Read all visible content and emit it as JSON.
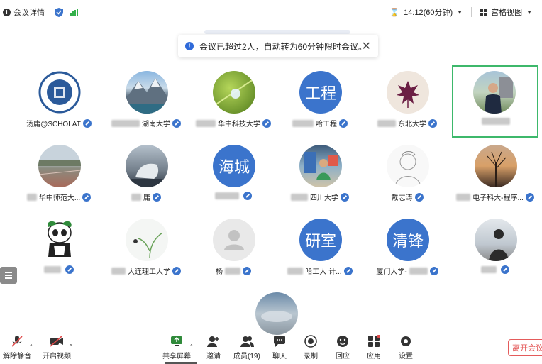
{
  "topbar": {
    "meeting_details": "会议详情",
    "timer": "14:12(60分钟)",
    "view_mode": "宫格视图"
  },
  "toast": {
    "message": "会议已超过2人，自动转为60分钟限时会议。"
  },
  "participants": [
    {
      "name": "汤庸@SCHOLAT",
      "avatar": "logo"
    },
    {
      "name": "湖南大学",
      "avatar": "mountain"
    },
    {
      "name": "华中科技大学",
      "avatar": "drop"
    },
    {
      "name": "哈工程",
      "avatar": "text",
      "text": "工程"
    },
    {
      "name": "东北大学",
      "avatar": "leaf"
    },
    {
      "name": "",
      "avatar": "person"
    },
    {
      "name": "华中师范大...",
      "avatar": "field"
    },
    {
      "name": "庸",
      "avatar": "seal"
    },
    {
      "name": "",
      "avatar": "text",
      "text": "海城"
    },
    {
      "name": "四川大学",
      "avatar": "desk"
    },
    {
      "name": "戴志涛",
      "avatar": "sketch"
    },
    {
      "name": "电子科大-程序...",
      "avatar": "tree"
    },
    {
      "name": "",
      "avatar": "panda"
    },
    {
      "name": "大连理工大学",
      "avatar": "plant"
    },
    {
      "name": "杨",
      "avatar": "default"
    },
    {
      "name": "哈工大 计...",
      "avatar": "text",
      "text": "研室"
    },
    {
      "name": "厦门大学-",
      "avatar": "text",
      "text": "清锋"
    },
    {
      "name": "",
      "avatar": "person2"
    },
    {
      "name": "",
      "avatar": "sky"
    }
  ],
  "toolbar": {
    "unmute": "解除静音",
    "start_video": "开启视频",
    "share_screen": "共享屏幕",
    "invite": "邀请",
    "members": "成员(19)",
    "chat": "聊天",
    "record": "录制",
    "replay": "回应",
    "apps": "应用",
    "settings": "设置",
    "leave": "离开会议"
  },
  "colors": {
    "accent": "#3b74cc",
    "active_border": "#3db86b",
    "leave": "#e45b5b"
  }
}
